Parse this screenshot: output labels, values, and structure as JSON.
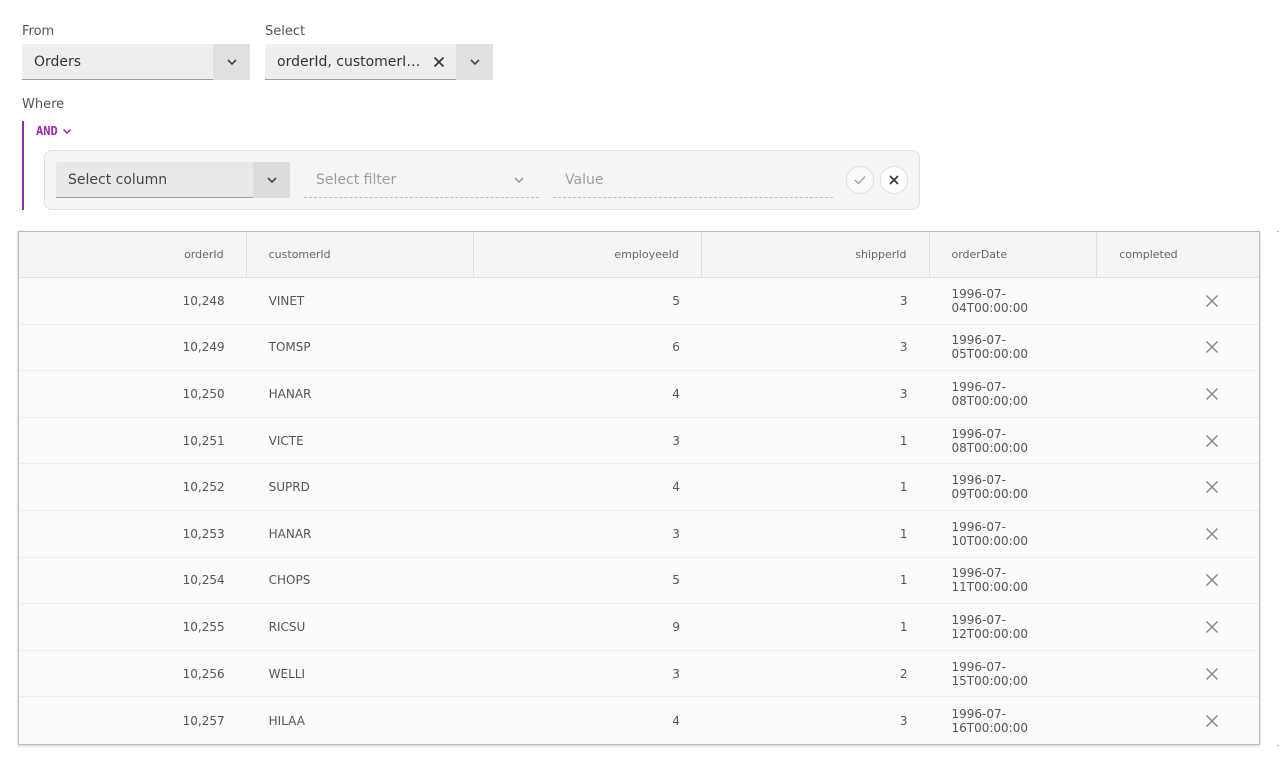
{
  "from": {
    "label": "From",
    "value": "Orders"
  },
  "select": {
    "label": "Select",
    "value": "orderId, customerId, employeeId, shipperId, orderDate, completed"
  },
  "where": {
    "label": "Where",
    "operator": "AND",
    "rule": {
      "column_placeholder": "Select column",
      "filter_placeholder": "Select filter",
      "value_placeholder": "Value"
    }
  },
  "table": {
    "columns": [
      "orderId",
      "customerId",
      "employeeId",
      "shipperId",
      "orderDate",
      "completed"
    ],
    "rows": [
      {
        "orderId": "10,248",
        "customerId": "VINET",
        "employeeId": "5",
        "shipperId": "3",
        "orderDate": "1996-07-04T00:00:00",
        "completed": false
      },
      {
        "orderId": "10,249",
        "customerId": "TOMSP",
        "employeeId": "6",
        "shipperId": "3",
        "orderDate": "1996-07-05T00:00:00",
        "completed": false
      },
      {
        "orderId": "10,250",
        "customerId": "HANAR",
        "employeeId": "4",
        "shipperId": "3",
        "orderDate": "1996-07-08T00:00:00",
        "completed": false
      },
      {
        "orderId": "10,251",
        "customerId": "VICTE",
        "employeeId": "3",
        "shipperId": "1",
        "orderDate": "1996-07-08T00:00:00",
        "completed": false
      },
      {
        "orderId": "10,252",
        "customerId": "SUPRD",
        "employeeId": "4",
        "shipperId": "1",
        "orderDate": "1996-07-09T00:00:00",
        "completed": false
      },
      {
        "orderId": "10,253",
        "customerId": "HANAR",
        "employeeId": "3",
        "shipperId": "1",
        "orderDate": "1996-07-10T00:00:00",
        "completed": false
      },
      {
        "orderId": "10,254",
        "customerId": "CHOPS",
        "employeeId": "5",
        "shipperId": "1",
        "orderDate": "1996-07-11T00:00:00",
        "completed": false
      },
      {
        "orderId": "10,255",
        "customerId": "RICSU",
        "employeeId": "9",
        "shipperId": "1",
        "orderDate": "1996-07-12T00:00:00",
        "completed": false
      },
      {
        "orderId": "10,256",
        "customerId": "WELLI",
        "employeeId": "3",
        "shipperId": "2",
        "orderDate": "1996-07-15T00:00:00",
        "completed": false
      },
      {
        "orderId": "10,257",
        "customerId": "HILAA",
        "employeeId": "4",
        "shipperId": "3",
        "orderDate": "1996-07-16T00:00:00",
        "completed": false
      }
    ]
  },
  "colors": {
    "accent": "#9c27b0",
    "field_bg": "#eeeeee",
    "grid_bg": "#fafafa"
  },
  "icons": {
    "dropdown": "chevron-down-icon",
    "clear": "close-icon",
    "apply": "check-icon",
    "remove": "close-icon",
    "false_value": "close-icon"
  }
}
